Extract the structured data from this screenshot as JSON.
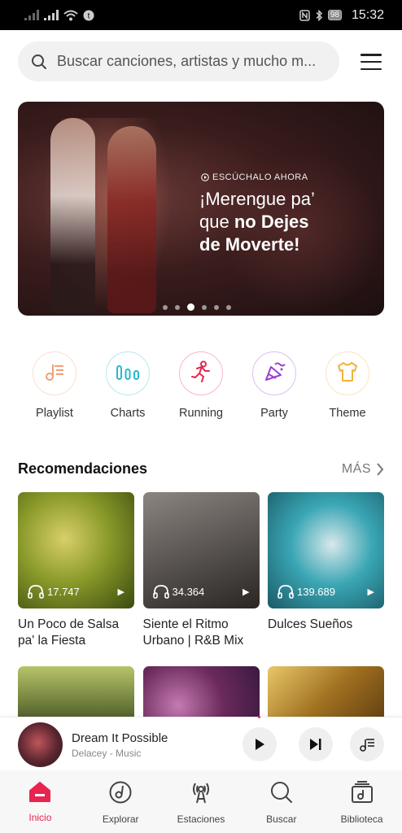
{
  "status_bar": {
    "battery": "98",
    "time": "15:32"
  },
  "search": {
    "placeholder": "Buscar canciones, artistas y mucho m..."
  },
  "banner": {
    "kicker": "ESCÚCHALO AHORA",
    "title_line1": "¡Merengue pa’",
    "title_line2_plain": "que ",
    "title_line2_bold": "no Dejes",
    "title_line3_bold": "de Moverte!",
    "dot_count": 6,
    "active_dot": 3
  },
  "categories": [
    {
      "label": "Playlist",
      "icon": "playlist-icon",
      "color": "#f0a078"
    },
    {
      "label": "Charts",
      "icon": "charts-icon",
      "color": "#27b9c9"
    },
    {
      "label": "Running",
      "icon": "running-icon",
      "color": "#e8254f"
    },
    {
      "label": "Party",
      "icon": "party-icon",
      "color": "#9b3fd1"
    },
    {
      "label": "Theme",
      "icon": "theme-icon",
      "color": "#f2b23a"
    }
  ],
  "recommendations": {
    "title": "Recomendaciones",
    "more": "MÁS",
    "items": [
      {
        "plays": "17.747",
        "title": "Un Poco de Salsa pa' la Fiesta",
        "color": "#8a9a2a"
      },
      {
        "plays": "34.364",
        "title": "Siente el Ritmo Urbano | R&B Mix",
        "color": "#5a5552"
      },
      {
        "plays": "139.689",
        "title": "Dulces Sueños",
        "color": "#3aa6b4"
      }
    ]
  },
  "player": {
    "title": "Dream It Possible",
    "subtitle": "Delacey - Music"
  },
  "nav": [
    {
      "label": "Inicio",
      "icon": "home-icon",
      "active": true
    },
    {
      "label": "Explorar",
      "icon": "explore-icon",
      "active": false
    },
    {
      "label": "Estaciones",
      "icon": "stations-icon",
      "active": false
    },
    {
      "label": "Buscar",
      "icon": "search-icon",
      "active": false
    },
    {
      "label": "Biblioteca",
      "icon": "library-icon",
      "active": false
    }
  ],
  "colors": {
    "accent": "#e8254f"
  }
}
